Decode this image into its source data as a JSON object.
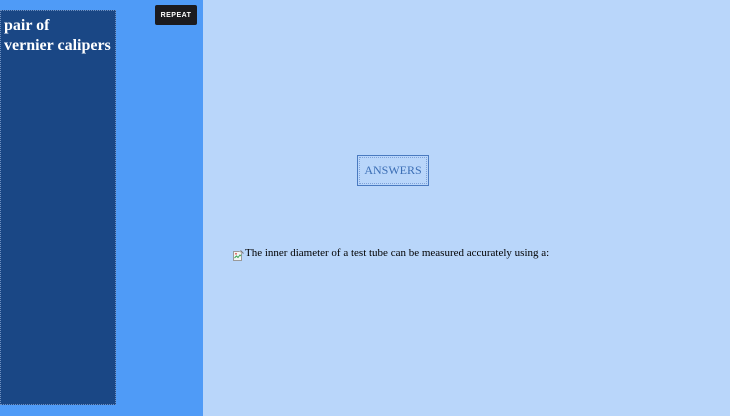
{
  "answer_panel": {
    "answer_text": "pair of\nvernier calipers"
  },
  "toolbar": {
    "repeat_label": "REPEAT"
  },
  "main": {
    "answers_label": "ANSWERS",
    "question_text": "The inner diameter of a test tube can be measured accurately using a:",
    "question_image_icon": "broken-image-icon"
  },
  "colors": {
    "page_background": "#b9d6fa",
    "left_panel": "#4f9bf7",
    "answer_card": "#1a4785",
    "repeat_button": "#1b1b1f",
    "answers_button_text": "#3b6eb5"
  }
}
